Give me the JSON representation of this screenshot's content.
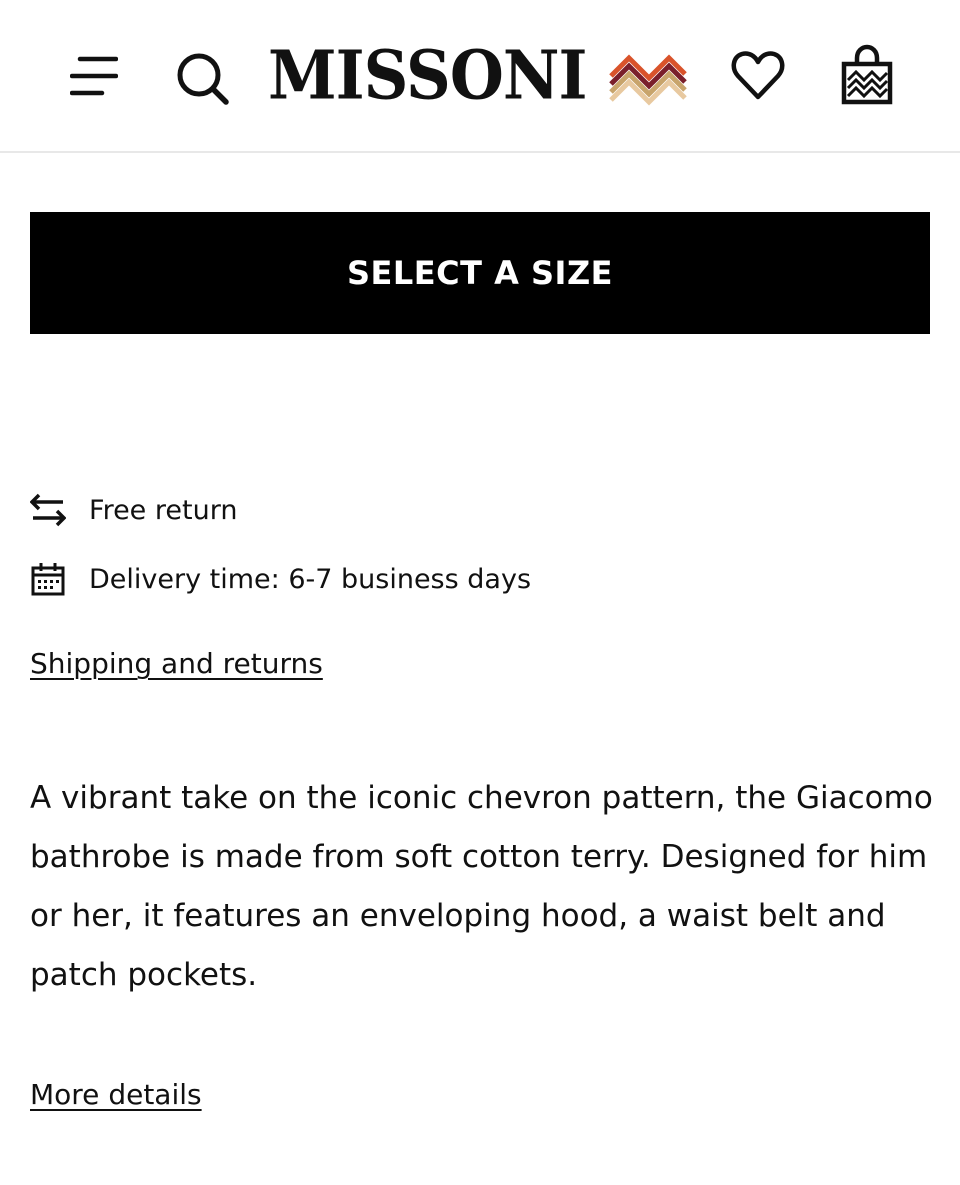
{
  "header": {
    "brand": "MISSONI",
    "icons": {
      "menu": "menu-icon",
      "search": "search-icon",
      "wishlist": "heart-icon",
      "bag": "shopping-bag-icon"
    },
    "logo_colors": [
      "#C8A46B",
      "#7A1F2B",
      "#D9532B",
      "#E8C9A0"
    ]
  },
  "main": {
    "select_size_label": "SELECT A SIZE",
    "features": [
      {
        "icon": "arrows-swap-icon",
        "text": "Free return"
      },
      {
        "icon": "calendar-icon",
        "text": "Delivery time: 6-7 business days"
      }
    ],
    "shipping_link": "Shipping and returns",
    "description": "A vibrant take on the iconic chevron pattern, the Giacomo bathrobe is made from soft cotton terry. Designed for him or her, it features an enveloping hood, a waist belt and patch pockets.",
    "more_details_link": "More details"
  },
  "colors": {
    "button_bg": "#000000",
    "button_text": "#FFFFFF",
    "text": "#111111",
    "divider": "#E8E8E8"
  }
}
